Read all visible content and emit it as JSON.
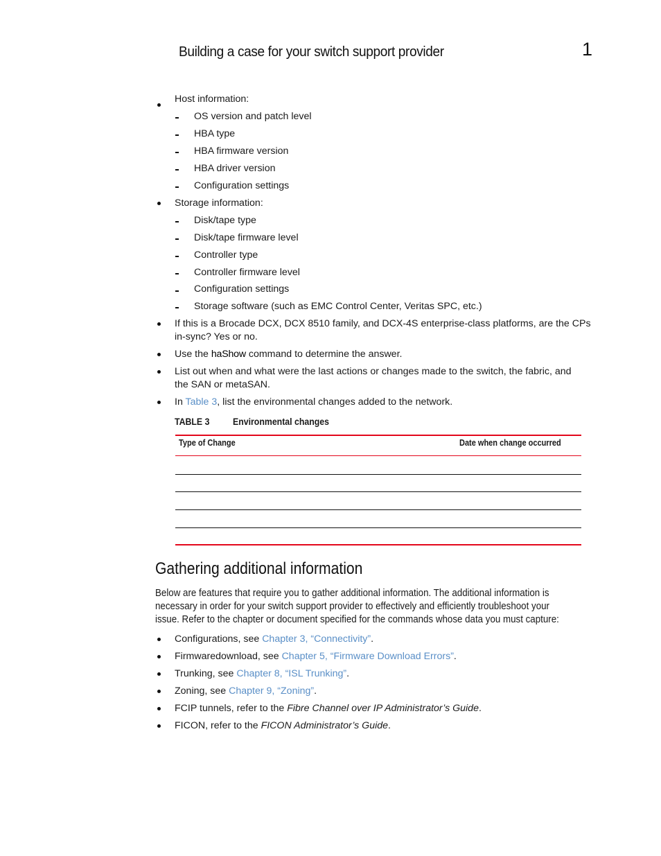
{
  "header": {
    "title": "Building a case for your switch support provider",
    "chapter_number": "1"
  },
  "info_list": {
    "host": {
      "label": "Host information:",
      "items": [
        "OS version and patch level",
        "HBA type",
        "HBA firmware version",
        "HBA driver version",
        "Configuration settings"
      ]
    },
    "storage": {
      "label": "Storage information:",
      "items": [
        "Disk/tape type",
        "Disk/tape firmware level",
        "Controller type",
        "Controller firmware level",
        "Configuration settings",
        "Storage software (such as EMC Control Center, Veritas SPC, etc.)"
      ]
    },
    "dcx": {
      "line1": "If this is a Brocade DCX, DCX 8510 family, and DCX-4S enterprise-class platforms, are the CPs",
      "line2": "in-sync? Yes or no."
    },
    "hashow": {
      "prefix": "Use the ",
      "command": "haShow",
      "suffix": " command to determine the answer."
    },
    "last_actions": {
      "line1": "List out when and what were the last actions or changes made to the switch, the fabric, and",
      "line2": "the SAN or metaSAN."
    },
    "table_ref": {
      "prefix": "In ",
      "link": "Table 3",
      "suffix": ", list the environmental changes added to the network."
    }
  },
  "table": {
    "number": "TABLE 3",
    "title": "Environmental changes",
    "columns": [
      "Type of Change",
      "Date when change occurred"
    ],
    "rows": [
      [
        "",
        ""
      ],
      [
        "",
        ""
      ],
      [
        "",
        ""
      ],
      [
        "",
        ""
      ],
      [
        "",
        ""
      ]
    ]
  },
  "section": {
    "heading": "Gathering additional information",
    "paragraph": [
      "Below are features that require you to gather additional information. The additional information is",
      "necessary in order for your switch support provider to effectively and efficiently troubleshoot your",
      "issue. Refer to the chapter or document specified for the commands whose data you must capture:"
    ],
    "items": [
      {
        "prefix": "Configurations, see ",
        "link": "Chapter 3, “Connectivity”",
        "suffix": "."
      },
      {
        "prefix": "Firmwaredownload, see ",
        "link": "Chapter 5, “Firmware Download Errors”",
        "suffix": "."
      },
      {
        "prefix": "Trunking, see ",
        "link": "Chapter 8, “ISL Trunking”",
        "suffix": "."
      },
      {
        "prefix": "Zoning, see ",
        "link": "Chapter 9, “Zoning”",
        "suffix": "."
      },
      {
        "prefix": "FCIP tunnels, refer to the ",
        "italic": "Fibre Channel over IP Administrator’s Guide",
        "suffix": "."
      },
      {
        "prefix": "FICON, refer to the ",
        "italic": "FICON Administrator’s Guide",
        "suffix": "."
      }
    ]
  },
  "colors": {
    "link": "#5a8fc7",
    "table_rule_red": "#e3061b",
    "text": "#1a1a1a"
  }
}
